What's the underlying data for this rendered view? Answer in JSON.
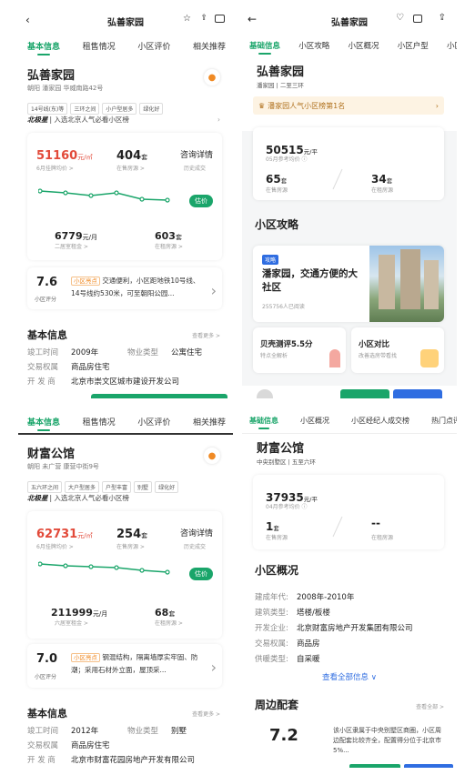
{
  "p1": {
    "title": "弘善家园",
    "tabs": [
      "基本信息",
      "租售情况",
      "小区评价",
      "相关推荐"
    ],
    "name": "弘善家园",
    "address": "朝阳 潘家园 华威南路42号",
    "tags": [
      "14号线(东)等",
      "三环之间",
      "小户型居多",
      "绿化好"
    ],
    "rank_brand": "北极星",
    "rank_text": "| 入选北京人气必看小区榜",
    "price": "51160",
    "price_unit": "元/㎡",
    "price_label": "6月挂牌均价 >",
    "on_sale": "404",
    "on_sale_unit": "套",
    "on_sale_label": "在售房源 >",
    "consult": "咨询详情",
    "consult_sub": "历史成交",
    "estimate_btn": "估价",
    "rent": "6779",
    "rent_unit": "元/月",
    "rent_label": "二居室租金 >",
    "on_rent": "603",
    "on_rent_unit": "套",
    "on_rent_label": "在租房源 >",
    "score": "7.6",
    "score_label": "小区评分",
    "highlight_tag": "小区亮点",
    "highlight_text": "交通便利，小区距地铁10号线、14号线约530米，可至朝阳公园...",
    "basic_title": "基本信息",
    "view_more": "查看更多 >",
    "info": [
      {
        "k": "竣工时间",
        "v": "2009年",
        "k2": "物业类型",
        "v2": "公寓住宅"
      },
      {
        "k": "交易权属",
        "v": "商品房住宅",
        "k2": "",
        "v2": ""
      },
      {
        "k": "开 发 商",
        "v": "北京市崇文区城市建设开发公司",
        "k2": "",
        "v2": ""
      }
    ]
  },
  "p2": {
    "title": "弘善家园",
    "tabs": [
      "基础信息",
      "小区攻略",
      "小区概况",
      "小区户型",
      "小区"
    ],
    "name": "弘善家园",
    "sub": [
      "潘家园",
      "二至三环"
    ],
    "rank_text": "潘家园人气小区榜第1名",
    "price": "50515",
    "price_unit": "元/平",
    "price_label": "05月参考均价 ⓘ",
    "sale": "65",
    "sale_unit": "套",
    "sale_label": "在售房源",
    "rent": "34",
    "rent_unit": "套",
    "rent_label": "在租房源",
    "guide_title": "小区攻略",
    "guide_tag": "攻略",
    "guide_heading": "潘家园，交通方便的大社区",
    "guide_reads": "255756人已阅读",
    "card1_title": "贝壳测评5.5分",
    "card1_sub": "特点全解析",
    "card2_title": "小区对比",
    "card2_sub": "改善选房带看找"
  },
  "p3": {
    "tabs": [
      "基本信息",
      "租售情况",
      "小区评价",
      "相关推荐"
    ],
    "name": "财富公馆",
    "address": "朝阳 未广营 康营中街9号",
    "tags": [
      "五六环之间",
      "大户型居多",
      "户型丰富",
      "别墅",
      "绿化好"
    ],
    "rank_brand": "北极星",
    "rank_text": "| 入选北京人气必看小区榜",
    "price": "62731",
    "price_unit": "元/㎡",
    "price_label": "6月挂牌均价 >",
    "on_sale": "254",
    "on_sale_unit": "套",
    "on_sale_label": "在售房源 >",
    "consult": "咨询详情",
    "consult_sub": "历史成交",
    "estimate_btn": "估价",
    "rent": "211999",
    "rent_unit": "元/月",
    "rent_label": "六居室租金 >",
    "on_rent": "68",
    "on_rent_unit": "套",
    "on_rent_label": "在租房源 >",
    "score": "7.0",
    "score_label": "小区评分",
    "highlight_tag": "小区亮点",
    "highlight_text": "钢混结构，隔离墙厚实牢固、防潮；采用石材外立面，屋顶采...",
    "basic_title": "基本信息",
    "view_more": "查看更多 >",
    "info": [
      {
        "k": "竣工时间",
        "v": "2012年",
        "k2": "物业类型",
        "v2": "别墅"
      },
      {
        "k": "交易权属",
        "v": "商品房住宅",
        "k2": "",
        "v2": ""
      },
      {
        "k": "开 发 商",
        "v": "北京市财富花园房地产开发有限公司",
        "k2": "",
        "v2": ""
      }
    ]
  },
  "p4": {
    "tabs": [
      "基础信息",
      "小区概况",
      "小区经纪人成交榜",
      "热门点评"
    ],
    "name": "财富公馆",
    "sub": [
      "中央别墅区",
      "五至六环"
    ],
    "price": "37935",
    "price_unit": "元/平",
    "price_label": "04月参考均价 ⓘ",
    "sale": "1",
    "sale_unit": "套",
    "sale_label": "在售房源",
    "rent": "--",
    "rent_label": "在租房源",
    "overview_title": "小区概况",
    "overview": [
      {
        "k": "建成年代:",
        "v": "2008年-2010年"
      },
      {
        "k": "建筑类型:",
        "v": "塔楼/板楼"
      },
      {
        "k": "开发企业:",
        "v": "北京财富房地产开发集团有限公司"
      },
      {
        "k": "交易权属:",
        "v": "商品房"
      },
      {
        "k": "供暖类型:",
        "v": "自采暖"
      }
    ],
    "view_all": "查看全部信息 ∨",
    "around_title": "周边配套",
    "around_more": "查看全部 >",
    "score": "7.2",
    "around_text": "该小区隶属于中央别墅区商圈，小区周边配套比较齐全，配置得分位于北京市5%..."
  },
  "colors": {
    "accent": "#1aa56a",
    "price": "#e24a3a"
  }
}
